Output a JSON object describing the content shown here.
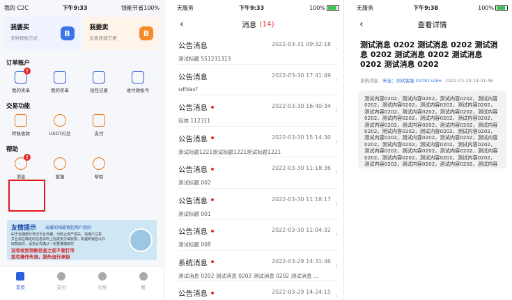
{
  "phone1": {
    "status": {
      "carrier": "",
      "app_label": "我的 C2C",
      "time": "下午9:33",
      "right": "钱能节省100%"
    },
    "quick": [
      {
        "title": "我要买",
        "sub": "多种转账方式"
      },
      {
        "title": "我要卖",
        "sub": "出售快捷方便"
      }
    ],
    "sections": {
      "orders": "订单账户",
      "trade": "交易功能",
      "help": "帮助"
    },
    "order_items": [
      "我的卖单",
      "我的买单",
      "钱包记录",
      "收付款账号"
    ],
    "trade_items": [
      "转账收款",
      "USDT闪兑",
      "支付"
    ],
    "help_items": [
      "消息",
      "客服",
      "帮助"
    ],
    "badge": "!",
    "banner": {
      "title": "友情提示",
      "subtitle": "亲爱的钱能钱包用户您好",
      "lines": [
        "由于近期部分非法平台诈骗，为防止资产损失，请用户注意",
        "并且请在确定的信息资料上完成支付或收款，如遇到钱包以外",
        "收款操作，请务必先确认一定要谨慎核实"
      ],
      "warn1": "没有收到到账信息之前不要打币",
      "warn2": "如有操作失误，损失自行承担"
    },
    "tabs": [
      "首页",
      "支付",
      "闪兑",
      "我"
    ]
  },
  "phone2": {
    "status": {
      "carrier": "无服务",
      "time": "下午9:33",
      "battery": "100%"
    },
    "title": "消息",
    "count": "(14)",
    "messages": [
      {
        "title": "公告消息",
        "unread": false,
        "date": "2022-03-31 09:32:18",
        "desc": "测试标题 551231313"
      },
      {
        "title": "公告消息",
        "unread": false,
        "date": "2022-03-30 17:41:49",
        "desc": "sdfdasf"
      },
      {
        "title": "公告消息",
        "unread": true,
        "date": "2022-03-30 16:40:34",
        "desc": "包体 112311"
      },
      {
        "title": "公告消息",
        "unread": true,
        "date": "2022-03-30 15:14:30",
        "desc": "测试标题1221测试标题1221测试标题1221"
      },
      {
        "title": "公告消息",
        "unread": true,
        "date": "2022-03-30 11:18:36",
        "desc": "测试标题 002"
      },
      {
        "title": "公告消息",
        "unread": true,
        "date": "2022-03-30 11:18:17",
        "desc": "测试标题 001"
      },
      {
        "title": "公告消息",
        "unread": true,
        "date": "2022-03-30 11:04:32",
        "desc": "测试标题 008"
      },
      {
        "title": "系统消息",
        "unread": true,
        "date": "2022-03-29 14:31:46",
        "desc": "测试消息 0202 测试消息 0202 测试消息 0202 测试消息 ..."
      },
      {
        "title": "公告消息",
        "unread": true,
        "date": "2022-03-29 14:24:15",
        "desc": ""
      }
    ]
  },
  "phone3": {
    "status": {
      "carrier": "无服务",
      "time": "下午9:38",
      "battery": "100%"
    },
    "title": "查看详情",
    "heading": "测试消息 0202 测试消息 0202 测试消息 0202 测试消息 0202 测试消息 0202 测试消息 0202",
    "type": "系统消息",
    "from": "来自：测试客服 020815266",
    "date": "2022-03-29 14:31:46",
    "body": "测试内容0202，测试内容0202，测试内容0202，测试内容0202，测试内容0202，测试内容0202，测试内容0202，测试内容0202，测试内容0202，测试内容0202，测试内容0202，测试内容0202，测试内容0202，测试内容0202，测试内容0202，测试内容0202，测试内容0202，测试内容0202，测试内容0202，测试内容0202，测试内容0202，测试内容0202，测试内容0202，测试内容0202，测试内容0202，测试内容0202，测试内容0202，测试内容0202，测试内容0202，测试内容0202，测试内容0202，测试内容0202，测试内容0202，测试内容0202，测试内容0202，测试内容0202，测试内容0202，测试内容0202，测试内容0202，"
  }
}
